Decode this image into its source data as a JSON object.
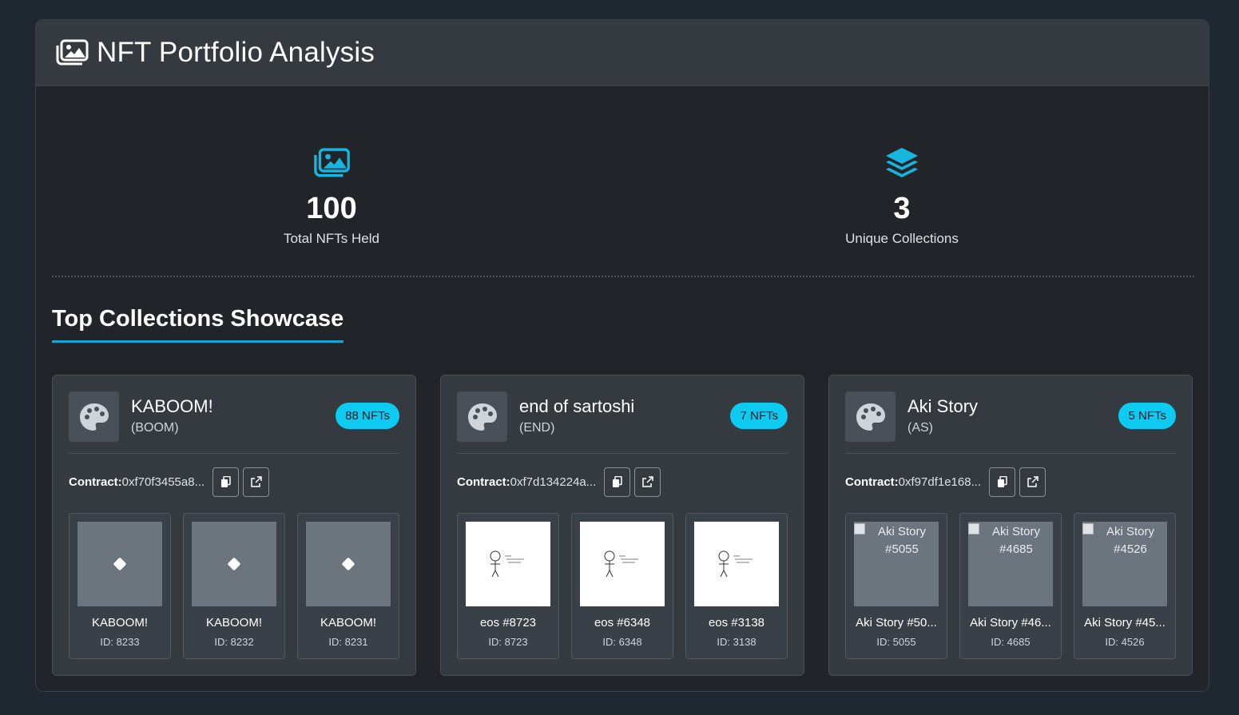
{
  "header": {
    "title": "NFT Portfolio Analysis",
    "icon": "images-icon"
  },
  "stats": [
    {
      "icon": "images-icon",
      "value": "100",
      "label": "Total NFTs Held"
    },
    {
      "icon": "layer-group-icon",
      "value": "3",
      "label": "Unique Collections"
    }
  ],
  "section_title": "Top Collections Showcase",
  "collections": [
    {
      "name": "KABOOM!",
      "symbol": "(BOOM)",
      "badge": "88 NFTs",
      "contract_label": "Contract:",
      "contract": "0xf70f3455a8...",
      "nfts": [
        {
          "name": "KABOOM!",
          "id": "ID: 8233"
        },
        {
          "name": "KABOOM!",
          "id": "ID: 8232"
        },
        {
          "name": "KABOOM!",
          "id": "ID: 8231"
        }
      ]
    },
    {
      "name": "end of sartoshi",
      "symbol": "(END)",
      "badge": "7 NFTs",
      "contract_label": "Contract:",
      "contract": "0xf7d134224a...",
      "nfts": [
        {
          "name": "eos #8723",
          "id": "ID: 8723"
        },
        {
          "name": "eos #6348",
          "id": "ID: 6348"
        },
        {
          "name": "eos #3138",
          "id": "ID: 3138"
        }
      ]
    },
    {
      "name": "Aki Story",
      "symbol": "(AS)",
      "badge": "5 NFTs",
      "contract_label": "Contract:",
      "contract": "0xf97df1e168...",
      "nfts": [
        {
          "name": "Aki Story #50...",
          "id": "ID: 5055",
          "alt": "Aki Story #5055"
        },
        {
          "name": "Aki Story #46...",
          "id": "ID: 4685",
          "alt": "Aki Story #4685"
        },
        {
          "name": "Aki Story #45...",
          "id": "ID: 4526",
          "alt": "Aki Story #4526"
        }
      ]
    }
  ],
  "colors": {
    "accent": "#0dcaf0",
    "page_bg": "#1f2731",
    "panel_bg": "#212529",
    "card_bg": "#343a40"
  }
}
